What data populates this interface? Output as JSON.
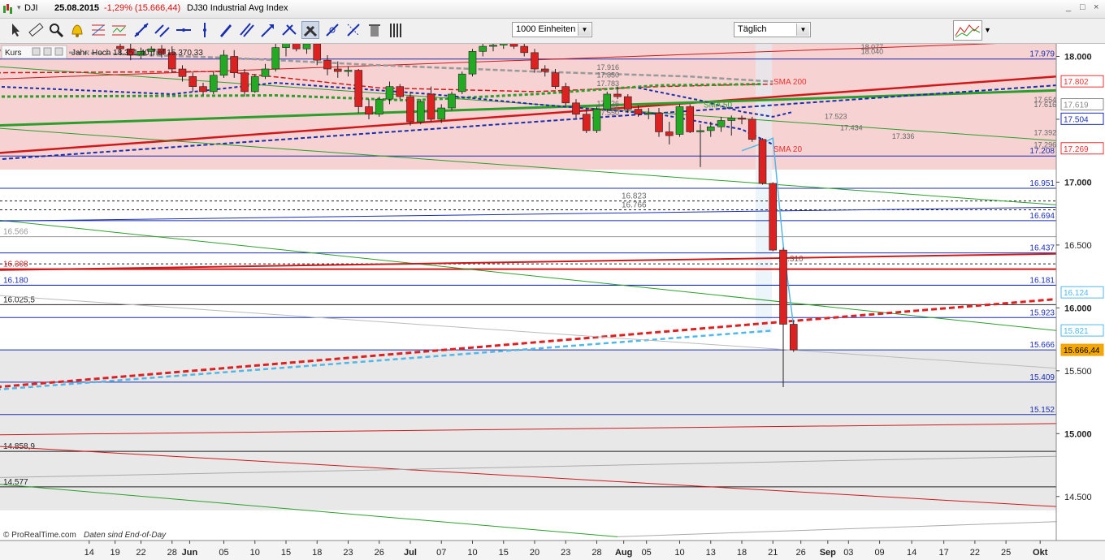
{
  "header": {
    "symbol": "DJI",
    "date": "25.08.2015",
    "change": "-1,29% (15.666,44)",
    "name": "DJ30 Industrial Avg Index",
    "window_controls": [
      "_",
      "□",
      "×"
    ]
  },
  "toolbar": {
    "units_value": "1000 Einheiten",
    "period_value": "Täglich",
    "icons": [
      "cursor-icon",
      "ruler-icon",
      "zoom-icon",
      "alarm-icon",
      "fibonacci-icon",
      "wave-icon",
      "trendline-icon",
      "channel-icon",
      "horizontal-line-icon",
      "vertical-line-icon",
      "pencil-icon",
      "parallel-icon",
      "arrow-icon",
      "tools-icon",
      "connect-icon",
      "edit-icon",
      "trash-icon",
      "bars-icon"
    ]
  },
  "overlay": {
    "kurs_label": "Kurs",
    "info_text": "Jahr: Hoch 18.351,40 Tief 15.370,33"
  },
  "footer": {
    "copyright": "© ProRealTime.com",
    "eod": "Daten sind End-of-Day"
  },
  "chart_data": {
    "type": "candlestick",
    "ylim": [
      14150,
      18100
    ],
    "y_ticks": [
      "18.000",
      "17.500",
      "17.000",
      "16.500",
      "16.000",
      "15.500",
      "15.000",
      "14.500"
    ],
    "x_labels": [
      {
        "label": "14",
        "i": -3
      },
      {
        "label": "19",
        "i": -0.5
      },
      {
        "label": "22",
        "i": 2
      },
      {
        "label": "28",
        "i": 5
      },
      {
        "label": "Jun",
        "i": 6.7
      },
      {
        "label": "05",
        "i": 10
      },
      {
        "label": "10",
        "i": 13
      },
      {
        "label": "15",
        "i": 16
      },
      {
        "label": "18",
        "i": 19
      },
      {
        "label": "23",
        "i": 22
      },
      {
        "label": "26",
        "i": 25
      },
      {
        "label": "Jul",
        "i": 28
      },
      {
        "label": "07",
        "i": 31
      },
      {
        "label": "10",
        "i": 34
      },
      {
        "label": "15",
        "i": 37
      },
      {
        "label": "20",
        "i": 40
      },
      {
        "label": "23",
        "i": 43
      },
      {
        "label": "28",
        "i": 46
      },
      {
        "label": "Aug",
        "i": 48.6
      },
      {
        "label": "05",
        "i": 50.8
      },
      {
        "label": "10",
        "i": 54
      },
      {
        "label": "13",
        "i": 57
      },
      {
        "label": "18",
        "i": 60
      },
      {
        "label": "21",
        "i": 63
      },
      {
        "label": "26",
        "i": 65.7
      },
      {
        "label": "Sep",
        "i": 68.3
      },
      {
        "label": "03",
        "i": 70.3
      },
      {
        "label": "09",
        "i": 73.3
      },
      {
        "label": "14",
        "i": 76.4
      },
      {
        "label": "17",
        "i": 79.5
      },
      {
        "label": "22",
        "i": 82.5
      },
      {
        "label": "25",
        "i": 85.5
      },
      {
        "label": "Okt",
        "i": 88.8
      }
    ],
    "candles": [
      {
        "o": 18080,
        "h": 18140,
        "l": 18010,
        "c": 18060
      },
      {
        "o": 18060,
        "h": 18100,
        "l": 17970,
        "c": 18010
      },
      {
        "o": 18010,
        "h": 18070,
        "l": 17980,
        "c": 18040
      },
      {
        "o": 18040,
        "h": 18080,
        "l": 18000,
        "c": 18060
      },
      {
        "o": 18060,
        "h": 18090,
        "l": 17990,
        "c": 18020
      },
      {
        "o": 18030,
        "h": 18080,
        "l": 17870,
        "c": 17900
      },
      {
        "o": 17900,
        "h": 17930,
        "l": 17800,
        "c": 17840
      },
      {
        "o": 17840,
        "h": 17870,
        "l": 17720,
        "c": 17760
      },
      {
        "o": 17760,
        "h": 17790,
        "l": 17690,
        "c": 17720
      },
      {
        "o": 17720,
        "h": 17880,
        "l": 17700,
        "c": 17850
      },
      {
        "o": 17850,
        "h": 18050,
        "l": 17830,
        "c": 18010
      },
      {
        "o": 18000,
        "h": 18050,
        "l": 17830,
        "c": 17870
      },
      {
        "o": 17870,
        "h": 17900,
        "l": 17680,
        "c": 17720
      },
      {
        "o": 17720,
        "h": 17860,
        "l": 17710,
        "c": 17840
      },
      {
        "o": 17840,
        "h": 17940,
        "l": 17820,
        "c": 17900
      },
      {
        "o": 17900,
        "h": 18100,
        "l": 17880,
        "c": 18070
      },
      {
        "o": 18070,
        "h": 18180,
        "l": 18000,
        "c": 18120
      },
      {
        "o": 18120,
        "h": 18200,
        "l": 18040,
        "c": 18060
      },
      {
        "o": 18060,
        "h": 18130,
        "l": 18020,
        "c": 18100
      },
      {
        "o": 18100,
        "h": 18150,
        "l": 17930,
        "c": 17970
      },
      {
        "o": 17970,
        "h": 18010,
        "l": 17850,
        "c": 17900
      },
      {
        "o": 17900,
        "h": 17960,
        "l": 17830,
        "c": 17880
      },
      {
        "o": 17880,
        "h": 17920,
        "l": 17840,
        "c": 17890
      },
      {
        "o": 17890,
        "h": 17900,
        "l": 17550,
        "c": 17600
      },
      {
        "o": 17600,
        "h": 17660,
        "l": 17500,
        "c": 17540
      },
      {
        "o": 17540,
        "h": 17680,
        "l": 17520,
        "c": 17660
      },
      {
        "o": 17660,
        "h": 17800,
        "l": 17620,
        "c": 17760
      },
      {
        "o": 17760,
        "h": 17780,
        "l": 17660,
        "c": 17680
      },
      {
        "o": 17680,
        "h": 17720,
        "l": 17450,
        "c": 17480
      },
      {
        "o": 17480,
        "h": 17660,
        "l": 17460,
        "c": 17640
      },
      {
        "o": 17700,
        "h": 17760,
        "l": 17480,
        "c": 17500
      },
      {
        "o": 17500,
        "h": 17620,
        "l": 17470,
        "c": 17590
      },
      {
        "o": 17590,
        "h": 17720,
        "l": 17570,
        "c": 17700
      },
      {
        "o": 17720,
        "h": 17880,
        "l": 17700,
        "c": 17860
      },
      {
        "o": 17860,
        "h": 18060,
        "l": 17840,
        "c": 18040
      },
      {
        "o": 18040,
        "h": 18110,
        "l": 18000,
        "c": 18080
      },
      {
        "o": 18080,
        "h": 18120,
        "l": 18040,
        "c": 18090
      },
      {
        "o": 18090,
        "h": 18140,
        "l": 18060,
        "c": 18110
      },
      {
        "o": 18110,
        "h": 18140,
        "l": 18060,
        "c": 18080
      },
      {
        "o": 18080,
        "h": 18100,
        "l": 18000,
        "c": 18030
      },
      {
        "o": 18030,
        "h": 18060,
        "l": 17870,
        "c": 17900
      },
      {
        "o": 17900,
        "h": 17930,
        "l": 17840,
        "c": 17880
      },
      {
        "o": 17870,
        "h": 17900,
        "l": 17740,
        "c": 17760
      },
      {
        "o": 17760,
        "h": 17790,
        "l": 17610,
        "c": 17630
      },
      {
        "o": 17630,
        "h": 17660,
        "l": 17510,
        "c": 17540
      },
      {
        "o": 17540,
        "h": 17580,
        "l": 17390,
        "c": 17410
      },
      {
        "o": 17410,
        "h": 17600,
        "l": 17390,
        "c": 17580
      },
      {
        "o": 17580,
        "h": 17720,
        "l": 17560,
        "c": 17700
      },
      {
        "o": 17700,
        "h": 17760,
        "l": 17660,
        "c": 17680
      },
      {
        "o": 17680,
        "h": 17700,
        "l": 17550,
        "c": 17580
      },
      {
        "o": 17580,
        "h": 17610,
        "l": 17520,
        "c": 17540
      },
      {
        "o": 17540,
        "h": 17590,
        "l": 17500,
        "c": 17550
      },
      {
        "o": 17550,
        "h": 17590,
        "l": 17360,
        "c": 17400
      },
      {
        "o": 17400,
        "h": 17480,
        "l": 17300,
        "c": 17370
      },
      {
        "o": 17380,
        "h": 17620,
        "l": 17360,
        "c": 17600
      },
      {
        "o": 17600,
        "h": 17620,
        "l": 17390,
        "c": 17400
      },
      {
        "o": 17400,
        "h": 17460,
        "l": 17120,
        "c": 17410
      },
      {
        "o": 17410,
        "h": 17480,
        "l": 17360,
        "c": 17440
      },
      {
        "o": 17440,
        "h": 17520,
        "l": 17400,
        "c": 17490
      },
      {
        "o": 17490,
        "h": 17530,
        "l": 17370,
        "c": 17510
      },
      {
        "o": 17510,
        "h": 17530,
        "l": 17460,
        "c": 17500
      },
      {
        "o": 17500,
        "h": 17520,
        "l": 17320,
        "c": 17340
      },
      {
        "o": 17340,
        "h": 17350,
        "l": 16980,
        "c": 16990
      },
      {
        "o": 16990,
        "h": 17000,
        "l": 16450,
        "c": 16460
      },
      {
        "o": 16460,
        "h": 16480,
        "l": 15370,
        "c": 15870
      },
      {
        "o": 15870,
        "h": 15900,
        "l": 15650,
        "c": 15666
      }
    ],
    "horizontal_levels": [
      {
        "value": 17979,
        "label": "17.979",
        "color": "#1a2eb0"
      },
      {
        "value": 17208,
        "label": "17.208",
        "color": "#1a2eb0"
      },
      {
        "value": 16951,
        "label": "16.951",
        "color": "#1a2eb0"
      },
      {
        "value": 16694,
        "label": "16.694",
        "color": "#1a2eb0"
      },
      {
        "value": 16437,
        "label": "16.437",
        "color": "#1a2eb0"
      },
      {
        "value": 16181,
        "label": "16.181",
        "color": "#1a2eb0"
      },
      {
        "value": 15923,
        "label": "15.923",
        "color": "#1a2eb0"
      },
      {
        "value": 15666,
        "label": "15.666",
        "color": "#1a2eb0"
      },
      {
        "value": 15409,
        "label": "15.409",
        "color": "#1a2eb0"
      },
      {
        "value": 15152,
        "label": "15.152",
        "color": "#1a2eb0"
      }
    ],
    "left_levels": [
      {
        "value": 16566,
        "label": "16.566",
        "color": "#9a9a9a"
      },
      {
        "value": 16308,
        "label": "16.308",
        "color": "#d01818"
      },
      {
        "value": 16180,
        "label": "16.180",
        "color": "#1a2eb0"
      },
      {
        "value": 16025.5,
        "label": "16.025,5",
        "color": "#222222"
      },
      {
        "value": 14858.9,
        "label": "14.858,9",
        "color": "#222222"
      },
      {
        "value": 14577,
        "label": "14.577",
        "color": "#222222"
      }
    ],
    "dashed_levels": [
      {
        "value": 16850,
        "label": "16.823"
      },
      {
        "value": 16780,
        "label": "16.766"
      },
      {
        "value": 16350,
        "label": "16.310"
      }
    ],
    "moving_averages": [
      {
        "name": "SMA 200",
        "value": 17802,
        "color": "#e83030"
      },
      {
        "name": "SMA 50",
        "value": 17619,
        "color": "#2aa02a"
      },
      {
        "name": "SMA 20",
        "value": 17269,
        "color": "#e83030"
      }
    ],
    "price_tags": [
      {
        "value": 17802,
        "label": "17.802",
        "color": "#e83030"
      },
      {
        "value": 17619,
        "label": "17.619",
        "color": "#8a8a8a"
      },
      {
        "value": 17504,
        "label": "17.504",
        "color": "#1a2eb0"
      },
      {
        "value": 17269,
        "label": "17.269",
        "color": "#e83030"
      },
      {
        "value": 16124,
        "label": "16.124",
        "color": "#4fb8e8"
      },
      {
        "value": 15821,
        "label": "15.821",
        "color": "#4fb8e8"
      },
      {
        "value": 15666.44,
        "label": "15.666,44",
        "color": "#f0a000"
      }
    ],
    "minor_labels": [
      {
        "value": 18073,
        "label": "18.077",
        "i": 38.5
      },
      {
        "value": 18040,
        "label": "18.040",
        "i": 38.5
      },
      {
        "value": 17913,
        "label": "17.916",
        "i": 13
      },
      {
        "value": 17850,
        "label": "17.850",
        "i": 13
      },
      {
        "value": 17783,
        "label": "17.783",
        "i": 13
      },
      {
        "value": 17625,
        "label": "17.626",
        "i": 13
      },
      {
        "value": 17585,
        "label": "17.585",
        "i": 13
      },
      {
        "value": 17550,
        "label": "17.550",
        "i": 13
      },
      {
        "value": 17523,
        "label": "17.523",
        "i": 35
      },
      {
        "value": 17433,
        "label": "17.434",
        "i": 36.5
      },
      {
        "value": 17365,
        "label": "17.336",
        "i": 41.5
      },
      {
        "value": 17654,
        "label": "17.654",
        "i": 55.2
      },
      {
        "value": 17616,
        "label": "17.616",
        "i": 55.2
      },
      {
        "value": 17392,
        "label": "17.392",
        "i": 55.2
      },
      {
        "value": 17296,
        "label": "17.296",
        "i": 55.2
      }
    ]
  }
}
